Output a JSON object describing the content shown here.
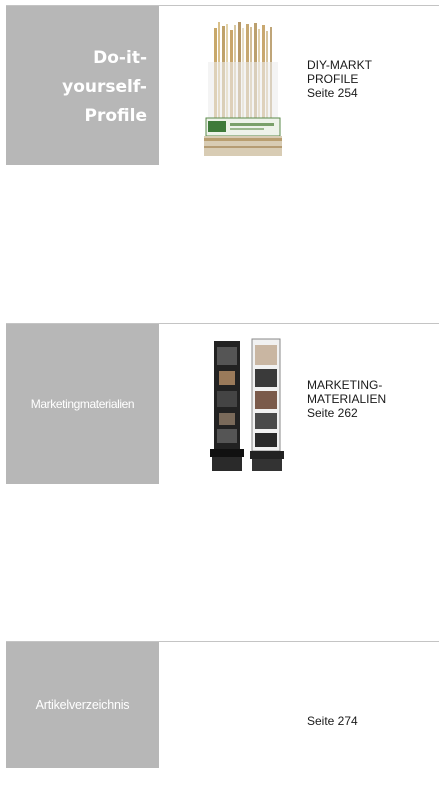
{
  "sections": [
    {
      "tab_lines": [
        "Do-it-",
        "yourself-",
        "Profile"
      ],
      "title_lines": [
        "DIY-MARKT",
        "PROFILE"
      ],
      "page": "Seite 254",
      "image": "diy-profile-display-rack"
    },
    {
      "tab_label": "Marketingmaterialien",
      "title_lines": [
        "MARKETING-",
        "MATERIALIEN"
      ],
      "page": "Seite 262",
      "image": "marketing-brochure-stands"
    },
    {
      "tab_label": "Artikelverzeichnis",
      "page": "Seite 274"
    }
  ],
  "colors": {
    "tab_background": "#b7b7b7",
    "tab_text": "#ffffff",
    "divider": "#c4c4c4",
    "body_text": "#1a1a1a"
  }
}
